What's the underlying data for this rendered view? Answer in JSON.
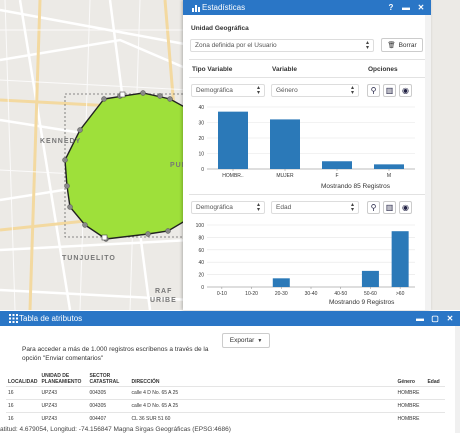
{
  "map_labels": {
    "kennedy": "KENNEDY",
    "puente": "PUENT",
    "tunjuelito": "TUNJUELITO",
    "rafael": "RAF",
    "uribe": "URIBE"
  },
  "stats_panel": {
    "title": "Estadísticas",
    "title_icons": [
      "chart-icon",
      "help-icon",
      "minimize-icon",
      "close-icon"
    ],
    "unidad_label": "Unidad Geográfica",
    "unidad_value": "Zona definida por el Usuario",
    "borrar_label": "Borrar",
    "col_tipo": "Tipo Variable",
    "col_variable": "Variable",
    "col_opciones": "Opciones",
    "row1": {
      "tipo": "Demográfica",
      "variable": "Género"
    },
    "row2": {
      "tipo": "Demográfica",
      "variable": "Edad"
    },
    "caption1": "Mostrando 85 Registros",
    "caption2": "Mostrando 9 Registros"
  },
  "chart_data": [
    {
      "type": "bar",
      "title": "",
      "xlabel": "",
      "ylabel": "",
      "categories": [
        "HOMBR..",
        "MUJER",
        "F",
        "M"
      ],
      "values": [
        37,
        32,
        5,
        3
      ],
      "ylim": [
        0,
        40
      ],
      "yticks": [
        0,
        10,
        20,
        30,
        40
      ],
      "color": "#2b79b8"
    },
    {
      "type": "bar",
      "title": "",
      "xlabel": "",
      "ylabel": "",
      "categories": [
        "0-10",
        "10-20",
        "20-30",
        "30-40",
        "40-50",
        "50-60",
        ">60"
      ],
      "values": [
        0,
        0,
        14,
        0,
        0,
        26,
        90
      ],
      "ylim": [
        0,
        100
      ],
      "yticks": [
        0,
        20,
        40,
        60,
        80,
        100
      ],
      "color": "#2b79b8"
    }
  ],
  "table_panel": {
    "title": "Tabla de atributos",
    "exportar_label": "Exportar",
    "info_text": "Para acceder a más de 1.000 registros escríbenos a través de la opción \"Enviar comentarios\"",
    "columns": [
      "LOCALIDAD",
      "UNIDAD DE PLANEAMIENTO",
      "SECTOR CATASTRAL",
      "DIRECCIÓN",
      "Género",
      "Edad"
    ],
    "rows": [
      [
        "16",
        "UPZ43",
        "004305",
        "calle 4 D No. 65 A 25",
        "HOMBRE",
        ""
      ],
      [
        "16",
        "UPZ43",
        "004305",
        "calle 4 D No. 65 A 25",
        "HOMBRE",
        ""
      ],
      [
        "16",
        "UPZ43",
        "004407",
        "CL 36 SUR 51 60",
        "HOMBRE",
        ""
      ]
    ]
  },
  "status": "atitud: 4.679054, Longitud: -74.156847 Magna Sirgas Geográficas (EPSG:4686)",
  "colors": {
    "accent": "#2a76c6",
    "polygon_fill": "#9ee03a",
    "bar": "#2b79b8"
  }
}
